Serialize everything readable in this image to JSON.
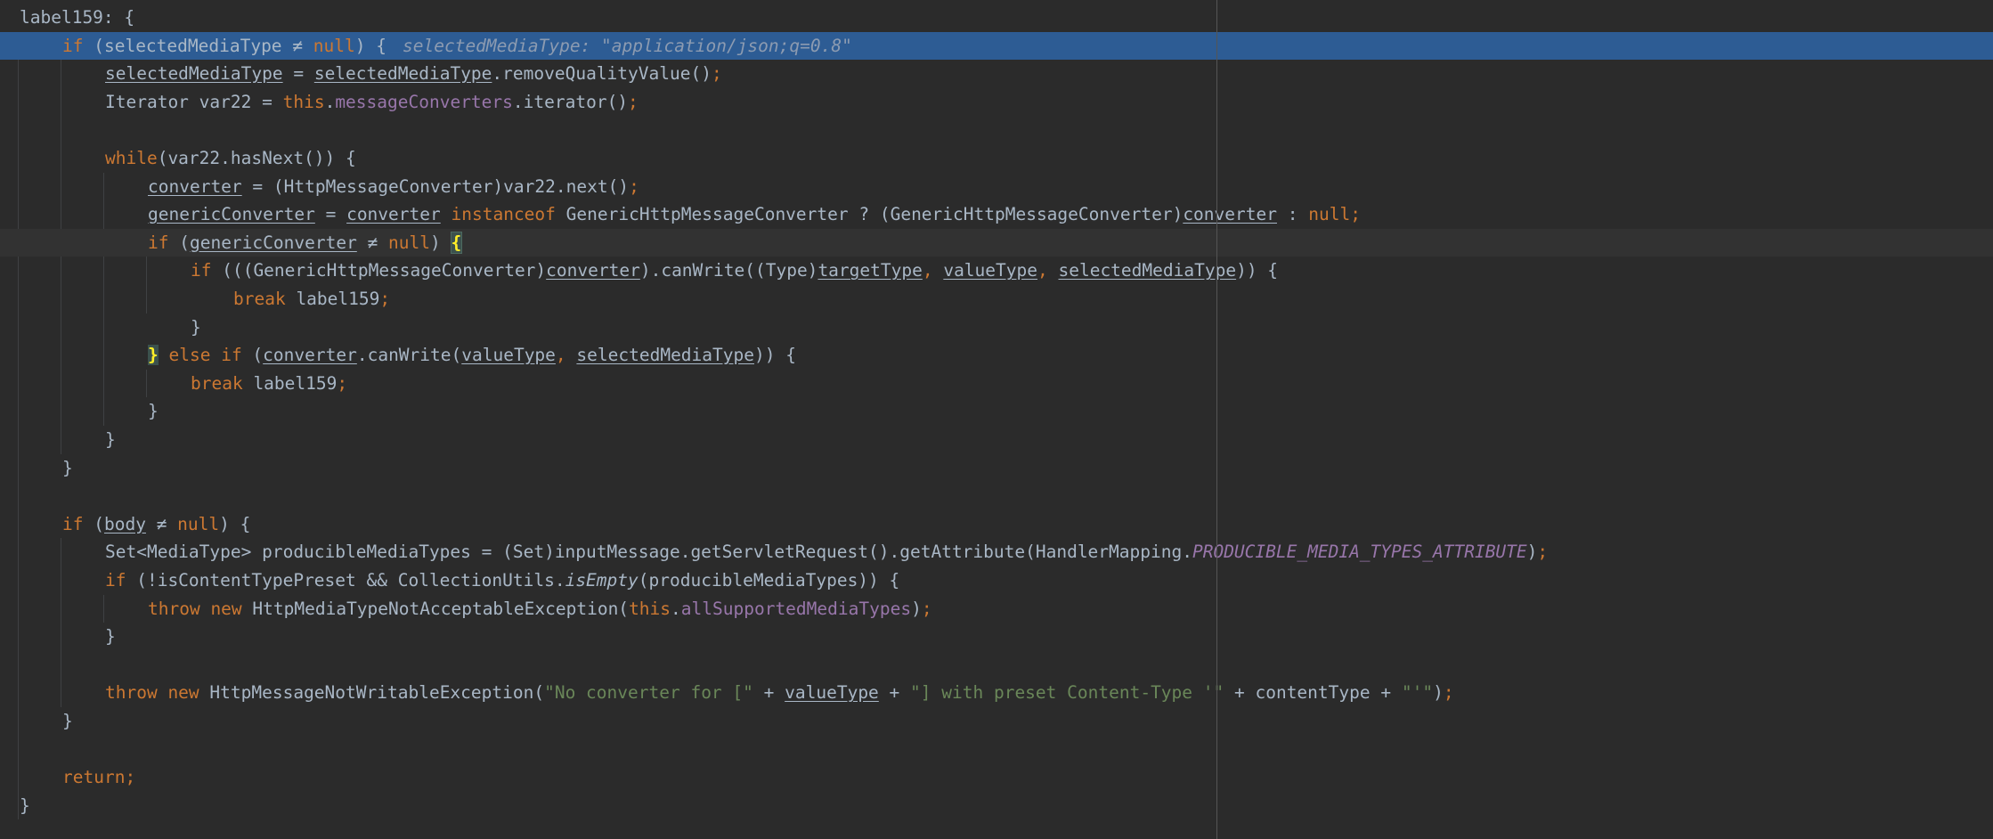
{
  "editor": {
    "right_margin_visible": true,
    "colors": {
      "background": "#2b2b2b",
      "execution_line": "#2d5c94",
      "keyword": "#cc7832",
      "field": "#9876aa",
      "string": "#6a8759",
      "default_text": "#a9b7c6"
    },
    "lines": [
      {
        "indent": 0,
        "tokens": [
          {
            "t": "label159: {"
          }
        ]
      },
      {
        "indent": 1,
        "highlight": "exec",
        "tokens": [
          {
            "t": "if",
            "c": "kw"
          },
          {
            "t": " ("
          },
          {
            "t": "selectedMediaType"
          },
          {
            "t": " ≠ "
          },
          {
            "t": "null",
            "c": "kw"
          },
          {
            "t": ") {"
          },
          {
            "t": "selectedMediaType: \"application/json;q=0.8\"",
            "c": "hint"
          }
        ]
      },
      {
        "indent": 2,
        "tokens": [
          {
            "t": "selectedMediaType",
            "c": "u"
          },
          {
            "t": " = "
          },
          {
            "t": "selectedMediaType",
            "c": "u"
          },
          {
            "t": ".removeQualityValue()"
          },
          {
            "t": ";",
            "c": "kw"
          }
        ]
      },
      {
        "indent": 2,
        "tokens": [
          {
            "t": "Iterator var22 = "
          },
          {
            "t": "this",
            "c": "kw"
          },
          {
            "t": "."
          },
          {
            "t": "messageConverters",
            "c": "field"
          },
          {
            "t": ".iterator()"
          },
          {
            "t": ";",
            "c": "kw"
          }
        ]
      },
      {
        "indent": 0,
        "tokens": []
      },
      {
        "indent": 2,
        "tokens": [
          {
            "t": "while",
            "c": "kw"
          },
          {
            "t": "(var22.hasNext()) {"
          }
        ]
      },
      {
        "indent": 3,
        "tokens": [
          {
            "t": "converter",
            "c": "u"
          },
          {
            "t": " = (HttpMessageConverter)var22.next()"
          },
          {
            "t": ";",
            "c": "kw"
          }
        ]
      },
      {
        "indent": 3,
        "tokens": [
          {
            "t": "genericConverter",
            "c": "u"
          },
          {
            "t": " = "
          },
          {
            "t": "converter",
            "c": "u"
          },
          {
            "t": " "
          },
          {
            "t": "instanceof",
            "c": "kw"
          },
          {
            "t": " GenericHttpMessageConverter ? (GenericHttpMessageConverter)"
          },
          {
            "t": "converter",
            "c": "u"
          },
          {
            "t": " : "
          },
          {
            "t": "null",
            "c": "kw"
          },
          {
            "t": ";",
            "c": "kw"
          }
        ]
      },
      {
        "indent": 3,
        "highlight": "caret",
        "tokens": [
          {
            "t": "if",
            "c": "kw"
          },
          {
            "t": " ("
          },
          {
            "t": "genericConverter",
            "c": "u"
          },
          {
            "t": " ≠ "
          },
          {
            "t": "null",
            "c": "kw"
          },
          {
            "t": ") "
          },
          {
            "t": "{",
            "c": "brace-hl"
          }
        ]
      },
      {
        "indent": 4,
        "tokens": [
          {
            "t": "if",
            "c": "kw"
          },
          {
            "t": " (((GenericHttpMessageConverter)"
          },
          {
            "t": "converter",
            "c": "u"
          },
          {
            "t": ").canWrite((Type)"
          },
          {
            "t": "targetType",
            "c": "u"
          },
          {
            "t": ", ",
            "c": "kw"
          },
          {
            "t": "valueType",
            "c": "u"
          },
          {
            "t": ", ",
            "c": "kw"
          },
          {
            "t": "selectedMediaType",
            "c": "u"
          },
          {
            "t": ")) {"
          }
        ]
      },
      {
        "indent": 5,
        "tokens": [
          {
            "t": "break",
            "c": "kw"
          },
          {
            "t": " label159"
          },
          {
            "t": ";",
            "c": "kw"
          }
        ]
      },
      {
        "indent": 4,
        "tokens": [
          {
            "t": "}"
          }
        ]
      },
      {
        "indent": 3,
        "tokens": [
          {
            "t": "}",
            "c": "brace-hl2"
          },
          {
            "t": " "
          },
          {
            "t": "else if",
            "c": "kw"
          },
          {
            "t": " ("
          },
          {
            "t": "converter",
            "c": "u"
          },
          {
            "t": ".canWrite("
          },
          {
            "t": "valueType",
            "c": "u"
          },
          {
            "t": ", ",
            "c": "kw"
          },
          {
            "t": "selectedMediaType",
            "c": "u"
          },
          {
            "t": ")) {"
          }
        ]
      },
      {
        "indent": 4,
        "tokens": [
          {
            "t": "break",
            "c": "kw"
          },
          {
            "t": " label159"
          },
          {
            "t": ";",
            "c": "kw"
          }
        ]
      },
      {
        "indent": 3,
        "tokens": [
          {
            "t": "}"
          }
        ]
      },
      {
        "indent": 2,
        "tokens": [
          {
            "t": "}"
          }
        ]
      },
      {
        "indent": 1,
        "tokens": [
          {
            "t": "}"
          }
        ]
      },
      {
        "indent": 0,
        "tokens": []
      },
      {
        "indent": 1,
        "tokens": [
          {
            "t": "if",
            "c": "kw"
          },
          {
            "t": " ("
          },
          {
            "t": "body",
            "c": "u"
          },
          {
            "t": " ≠ "
          },
          {
            "t": "null",
            "c": "kw"
          },
          {
            "t": ") {"
          }
        ]
      },
      {
        "indent": 2,
        "tokens": [
          {
            "t": "Set<MediaType> producibleMediaTypes = (Set)inputMessage.getServletRequest().getAttribute(HandlerMapping."
          },
          {
            "t": "PRODUCIBLE_MEDIA_TYPES_ATTRIBUTE",
            "c": "sfield"
          },
          {
            "t": ")"
          },
          {
            "t": ";",
            "c": "kw"
          }
        ]
      },
      {
        "indent": 2,
        "tokens": [
          {
            "t": "if",
            "c": "kw"
          },
          {
            "t": " (!isContentTypePreset && CollectionUtils."
          },
          {
            "t": "isEmpty",
            "c": "ital"
          },
          {
            "t": "(producibleMediaTypes)) {"
          }
        ]
      },
      {
        "indent": 3,
        "tokens": [
          {
            "t": "throw new",
            "c": "kw"
          },
          {
            "t": " HttpMediaTypeNotAcceptableException("
          },
          {
            "t": "this",
            "c": "kw"
          },
          {
            "t": "."
          },
          {
            "t": "allSupportedMediaTypes",
            "c": "field"
          },
          {
            "t": ")"
          },
          {
            "t": ";",
            "c": "kw"
          }
        ]
      },
      {
        "indent": 2,
        "tokens": [
          {
            "t": "}"
          }
        ]
      },
      {
        "indent": 0,
        "tokens": []
      },
      {
        "indent": 2,
        "tokens": [
          {
            "t": "throw new",
            "c": "kw"
          },
          {
            "t": " HttpMessageNotWritableException("
          },
          {
            "t": "\"No converter for [\"",
            "c": "str"
          },
          {
            "t": " + "
          },
          {
            "t": "valueType",
            "c": "u"
          },
          {
            "t": " + "
          },
          {
            "t": "\"] with preset Content-Type '\"",
            "c": "str"
          },
          {
            "t": " + contentType + "
          },
          {
            "t": "\"'\"",
            "c": "str"
          },
          {
            "t": ")"
          },
          {
            "t": ";",
            "c": "kw"
          }
        ]
      },
      {
        "indent": 1,
        "tokens": [
          {
            "t": "}"
          }
        ]
      },
      {
        "indent": 0,
        "tokens": []
      },
      {
        "indent": 1,
        "tokens": [
          {
            "t": "return",
            "c": "kw"
          },
          {
            "t": ";",
            "c": "kw"
          }
        ]
      },
      {
        "indent": 0,
        "tokens": [
          {
            "t": "}"
          }
        ]
      }
    ]
  }
}
